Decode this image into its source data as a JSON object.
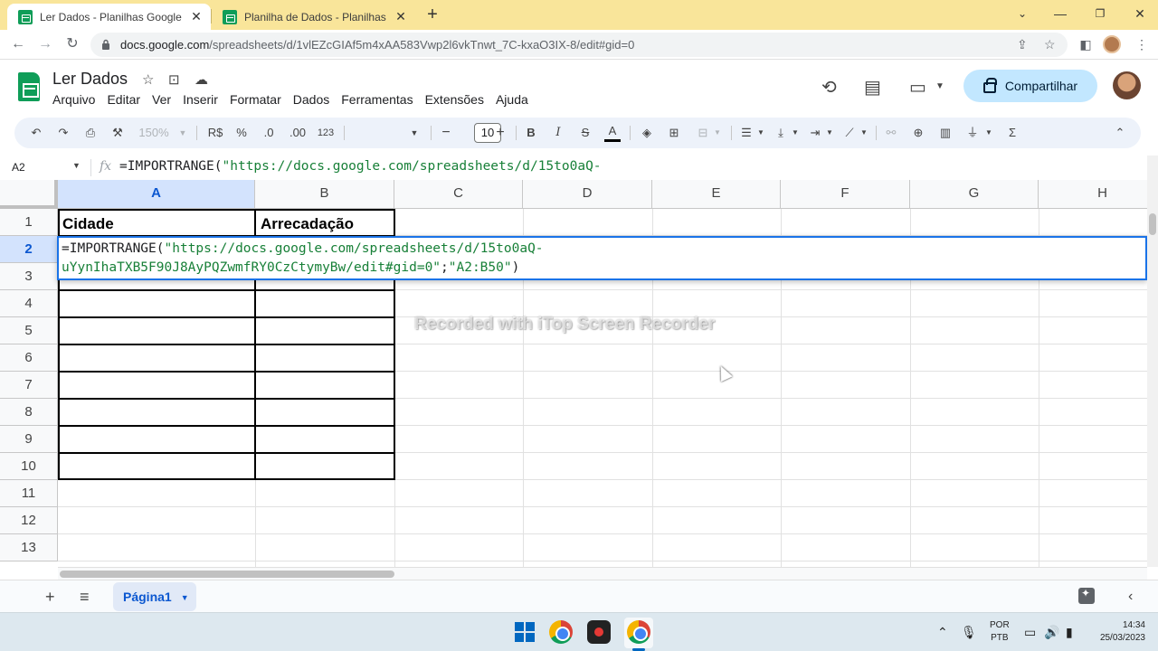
{
  "browser": {
    "tabs": [
      {
        "title": "Ler Dados - Planilhas Google",
        "active": true
      },
      {
        "title": "Planilha de Dados - Planilhas Goo",
        "active": false
      }
    ],
    "new_tab_label": "+",
    "window_controls": [
      "chevron-down",
      "minimize",
      "restore",
      "close"
    ],
    "url_host": "docs.google.com",
    "url_path": "/spreadsheets/d/1vlEZcGIAf5m4xAA583Vwp2l6vkTnwt_7C-kxaO3IX-8/edit#gid=0"
  },
  "sheets": {
    "doc_title": "Ler Dados",
    "menu": [
      "Arquivo",
      "Editar",
      "Ver",
      "Inserir",
      "Formatar",
      "Dados",
      "Ferramentas",
      "Extensões",
      "Ajuda"
    ],
    "share_label": "Compartilhar"
  },
  "toolbar": {
    "zoom": "150%",
    "currency": "R$",
    "percent": "%",
    "decimal_decrease": ".0",
    "decimal_increase": ".00",
    "number_format": "123",
    "font_size": "10",
    "bold": "B",
    "italic": "I",
    "strike": "S",
    "text_color": "A",
    "sum": "Σ"
  },
  "formula_bar": {
    "cell_ref": "A2",
    "fx": "fx",
    "formula_prefix": "=IMPORTRANGE(",
    "formula_string": "\"https://docs.google.com/spreadsheets/d/15to0aQ-"
  },
  "grid": {
    "columns": [
      "A",
      "B",
      "C",
      "D",
      "E",
      "F",
      "G",
      "H"
    ],
    "selected_column": "A",
    "rows": [
      "1",
      "2",
      "3",
      "4",
      "5",
      "6",
      "7",
      "8",
      "9",
      "10",
      "11",
      "12",
      "13"
    ],
    "selected_row": "2",
    "cells": {
      "A1": "Cidade",
      "B1": "Arrecadação"
    },
    "editor": {
      "prefix": "=IMPORTRANGE(",
      "line1_str": "\"https://docs.google.com/spreadsheets/d/15to0aQ-",
      "line2_str": "uYynIhaTXB5F90J8AyPQZwmfRY0CzCtymyBw/edit#gid=0\"",
      "separator": ";",
      "range_str": "\"A2:B50\"",
      "suffix": ")"
    },
    "watermark": "Recorded with iTop Screen Recorder"
  },
  "sheet_tabs": {
    "active_tab": "Página1"
  },
  "taskbar": {
    "lang_line1": "POR",
    "lang_line2": "PTB",
    "time": "14:34",
    "date": "25/03/2023"
  }
}
